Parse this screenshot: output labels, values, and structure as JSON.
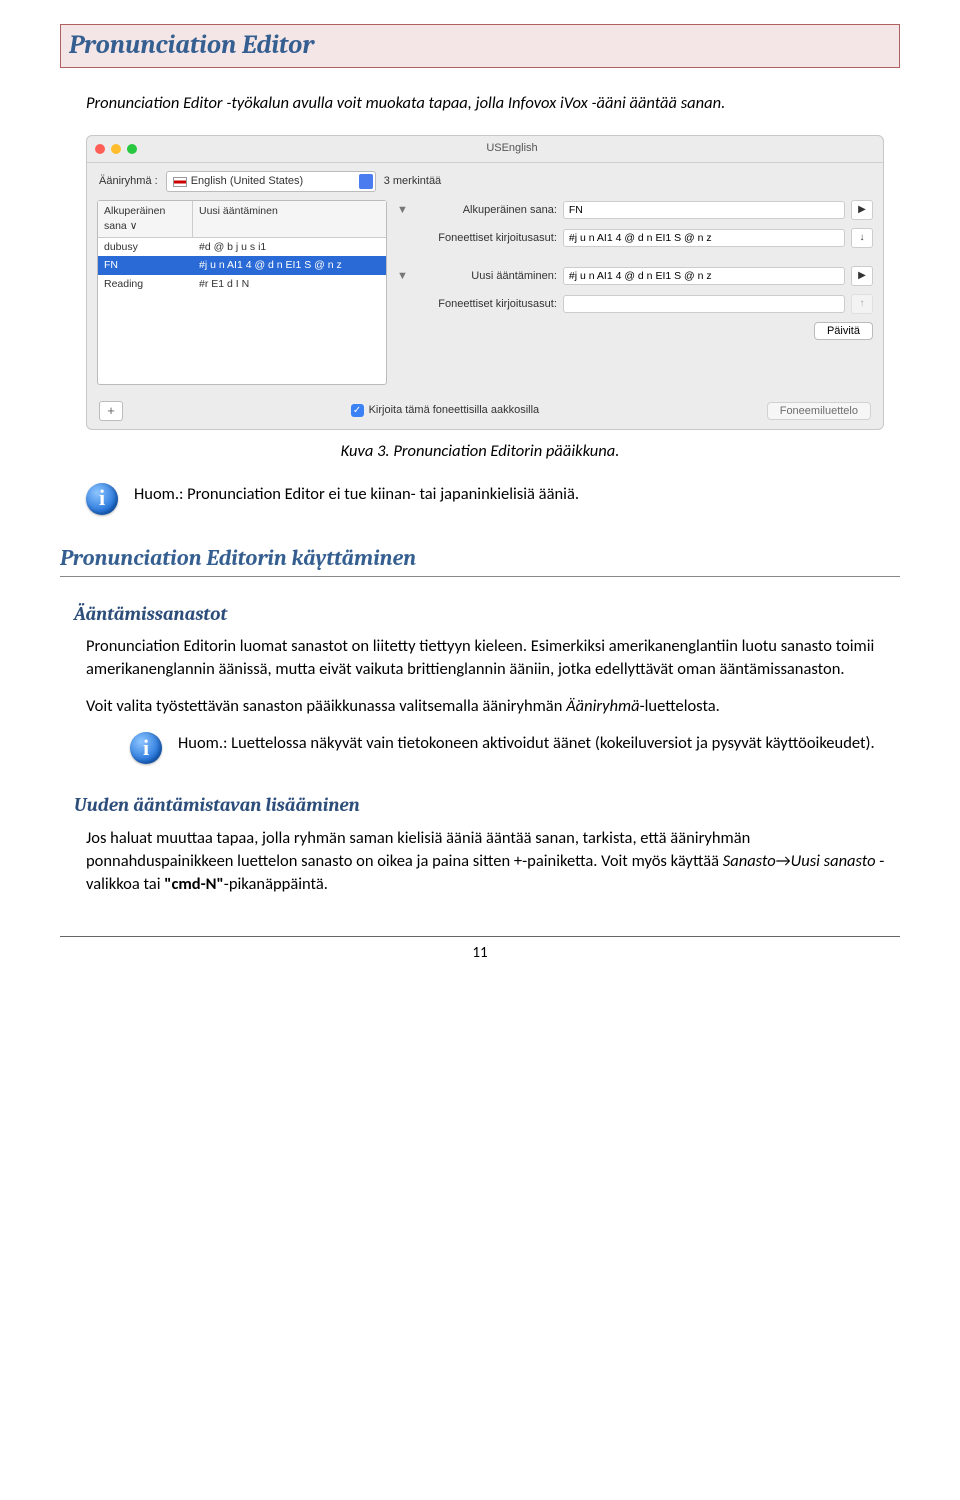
{
  "h1": "Pronunciation Editor",
  "intro": "Pronunciation Editor -työkalun avulla voit muokata tapaa, jolla Infovox iVox -ääni ääntää sanan.",
  "screenshot": {
    "title": "USEnglish",
    "group_label": "Ääniryhmä :",
    "group_value": "English (United States)",
    "entries_text": "3 merkintää",
    "cols": {
      "orig": "Alkuperäinen sana",
      "new": "Uusi ääntäminen"
    },
    "sort_indicator": "∨",
    "rows": [
      {
        "orig": "dubusy",
        "new": "#d @ b j u s i1"
      },
      {
        "orig": "FN",
        "new": "#j u n AI1 4 @ d n EI1 S @ n z"
      },
      {
        "orig": "Reading",
        "new": "#r E1 d I N"
      }
    ],
    "selected_row": 1,
    "form": {
      "orig_label": "Alkuperäinen sana:",
      "orig_value": "FN",
      "phon1_label": "Foneettiset kirjoitusasut:",
      "phon1_value": "#j u n AI1 4 @ d n EI1 S @ n z",
      "new_label": "Uusi ääntäminen:",
      "new_value": "#j u n AI1 4 @ d n EI1 S @ n z",
      "phon2_label": "Foneettiset kirjoitusasut:",
      "phon2_value": "",
      "update_btn": "Päivitä",
      "checkbox": "Kirjoita tämä foneettisilla aakkosilla",
      "phoneme_list_btn": "Foneemiluettelo"
    }
  },
  "caption": "Kuva 3. Pronunciation Editorin pääikkuna.",
  "note1": "Huom.: Pronunciation Editor ei tue kiinan- tai japaninkielisiä ääniä.",
  "h2": "Pronunciation Editorin käyttäminen",
  "sec1_h3": "Ääntämissanastot",
  "sec1_p1": "Pronunciation Editorin luomat sanastot on liitetty tiettyyn kieleen. Esimerkiksi amerikanenglantiin luotu sanasto toimii amerikanenglannin äänissä, mutta eivät vaikuta brittienglannin ääniin, jotka edellyttävät oman ääntämissanaston.",
  "sec1_p2a": "Voit valita työstettävän sanaston pääikkunassa valitsemalla ääniryhmän ",
  "sec1_p2b": "Ääniryhmä",
  "sec1_p2c": "-luettelosta.",
  "note2": "Huom.: Luettelossa näkyvät vain tietokoneen aktivoidut äänet (kokeiluversiot ja pysyvät käyttöoikeudet).",
  "sec2_h3": "Uuden ääntämistavan lisääminen",
  "sec2_p_a": "Jos haluat muuttaa tapaa, jolla ryhmän saman kielisiä ääniä ääntää sanan, tarkista, että ääniryhmän ponnahduspainikkeen luettelon sanasto on oikea ja paina sitten +-painiketta. Voit myös käyttää ",
  "sec2_p_b": "Sanasto",
  "sec2_p_arrow": "→",
  "sec2_p_c": "Uusi sanasto",
  "sec2_p_d": " -valikkoa tai ",
  "sec2_p_cmd": "\"cmd-N\"",
  "sec2_p_e": "-pikanäppäintä.",
  "page_number": "11"
}
